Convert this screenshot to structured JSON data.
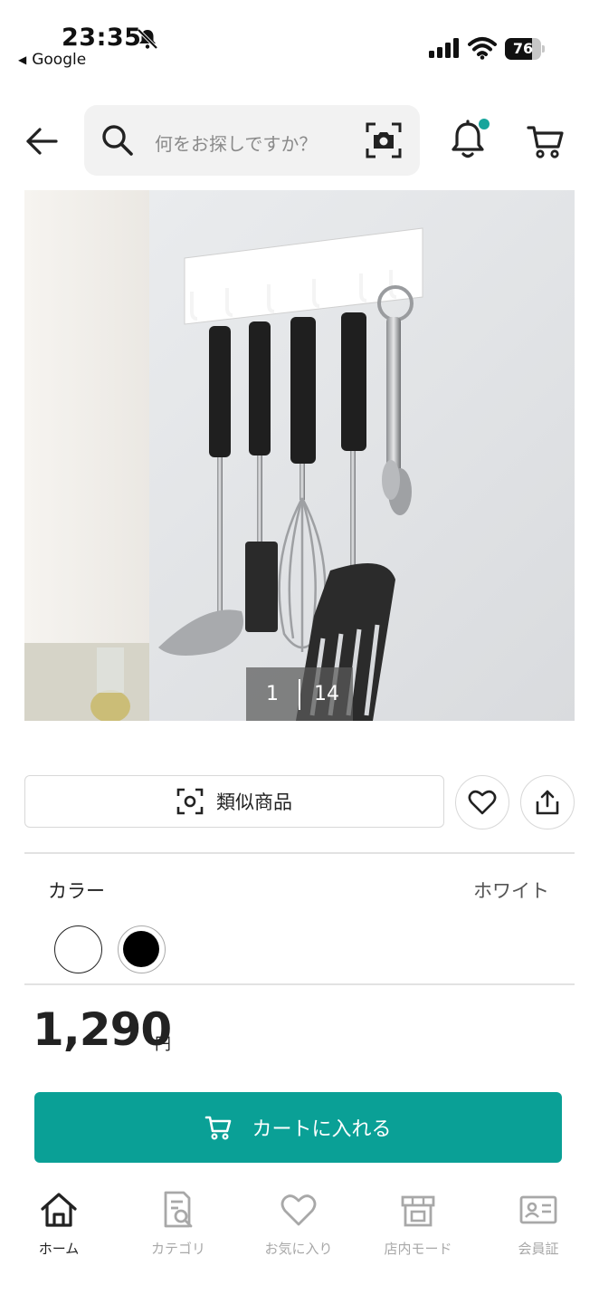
{
  "status_bar": {
    "time": "23:35",
    "back_app": "Google",
    "battery": "76",
    "battery_level": 0.76
  },
  "header": {
    "search_placeholder": "何をお探しですか？"
  },
  "product": {
    "image_index": "1",
    "image_total": "14",
    "similar_label": "類似商品",
    "color_label": "カラー",
    "color_value": "ホワイト",
    "color_options": [
      "white",
      "black"
    ],
    "price": "1,290",
    "price_unit": "円",
    "cart_label": "カートに入れる"
  },
  "bottom_nav": {
    "items": [
      {
        "label": "ホーム",
        "icon": "home-icon",
        "active": true
      },
      {
        "label": "カテゴリ",
        "icon": "category-icon",
        "active": false
      },
      {
        "label": "お気に入り",
        "icon": "heart-icon",
        "active": false
      },
      {
        "label": "店内モード",
        "icon": "store-icon",
        "active": false
      },
      {
        "label": "会員証",
        "icon": "member-card-icon",
        "active": false
      }
    ]
  },
  "colors": {
    "accent": "#0aa096",
    "notification_dot": "#16a59c",
    "text": "#222222",
    "inactive": "#a8a8a8"
  }
}
